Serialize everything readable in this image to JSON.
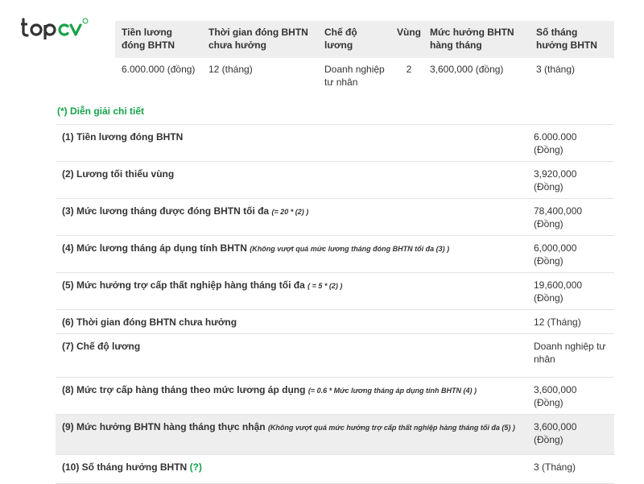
{
  "brand": {
    "logo_text": "topcv"
  },
  "summary": {
    "headers": [
      "Tiền lương đóng BHTN",
      "Thời gian đóng BHTN chưa hưởng",
      "Chế độ lương",
      "Vùng",
      "Mức hưởng BHTN hàng tháng",
      "Số tháng hưởng BHTN"
    ],
    "row": [
      "6.000.000 (đồng)",
      "12 (tháng)",
      "Doanh nghiệp tư nhân",
      "2",
      "3,600,000 (đồng)",
      "3 (tháng)"
    ]
  },
  "detail": {
    "title": "(*) Diễn giải chi tiết",
    "rows": [
      {
        "label": "(1) Tiền lương đóng BHTN",
        "note": "",
        "value": "6.000.000 (Đồng)"
      },
      {
        "label": "(2) Lương tối thiểu vùng",
        "note": "",
        "value": "3,920,000 (Đồng)"
      },
      {
        "label": "(3) Mức lương tháng được đóng BHTN tối đa",
        "note": "(= 20 * (2) )",
        "value": "78,400,000 (Đồng)"
      },
      {
        "label": "(4) Mức lương tháng áp dụng tính BHTN",
        "note": "(Không vượt quá mức lương tháng đóng BHTN tối đa (3) )",
        "value": "6,000,000 (Đồng)"
      },
      {
        "label": "(5) Mức hưởng trợ cấp thất nghiệp hàng tháng tối đa",
        "note": "( = 5 * (2) )",
        "value": "19,600,000 (Đồng)"
      },
      {
        "label": "(6) Thời gian đóng BHTN chưa hưởng",
        "note": "",
        "value": "12 (Tháng)"
      },
      {
        "label": "(7) Chế độ lương",
        "note": "",
        "value": "Doanh nghiệp tư nhân"
      },
      {
        "label": "(8) Mức trợ cấp hàng tháng theo mức lương áp dụng",
        "note": "(= 0.6 * Mức lương tháng áp dụng tính BHTN (4) )",
        "value": "3,600,000 (Đồng)"
      },
      {
        "label": "(9) Mức hưởng BHTN hàng tháng thực nhận",
        "note": "(Không vượt quá mức hưởng trợ cấp thất nghiệp hàng tháng tối đa (5) )",
        "value": "3,600,000 (Đồng)"
      },
      {
        "label": "(10) Số tháng hưởng BHTN",
        "note": "",
        "help": "(?)",
        "value": "3 (Tháng)"
      }
    ]
  },
  "colors": {
    "brand_dark": "#333333",
    "accent_green": "#16a34a",
    "header_bg": "#eeeeee"
  }
}
